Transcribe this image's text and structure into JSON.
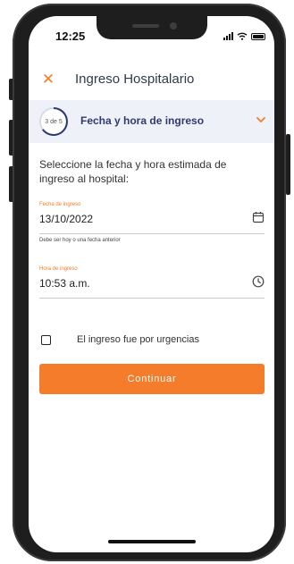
{
  "status_bar": {
    "time": "12:25"
  },
  "header": {
    "close_icon": "close-icon",
    "title": "Ingreso Hospitalario"
  },
  "step": {
    "current": 3,
    "total": 5,
    "counter_label": "3 de 5",
    "title": "Fecha y hora de ingreso",
    "chevron_icon": "chevron-down-icon"
  },
  "form": {
    "instructions": "Seleccione la fecha y hora estimada de ingreso al hospital:",
    "date_field": {
      "label": "Fecha de ingreso",
      "value": "13/10/2022",
      "helper": "Debe ser hoy o una fecha anterior",
      "icon": "calendar-icon"
    },
    "time_field": {
      "label": "Hora de ingreso",
      "value": "10:53 a.m.",
      "icon": "clock-icon"
    },
    "urgency_checkbox": {
      "label": "El ingreso fue por urgencias",
      "checked": false
    },
    "continue_label": "Continuar"
  },
  "colors": {
    "accent": "#f57c2a",
    "step_bar_bg": "#eef1f8",
    "title_text": "#2f3a6f"
  }
}
